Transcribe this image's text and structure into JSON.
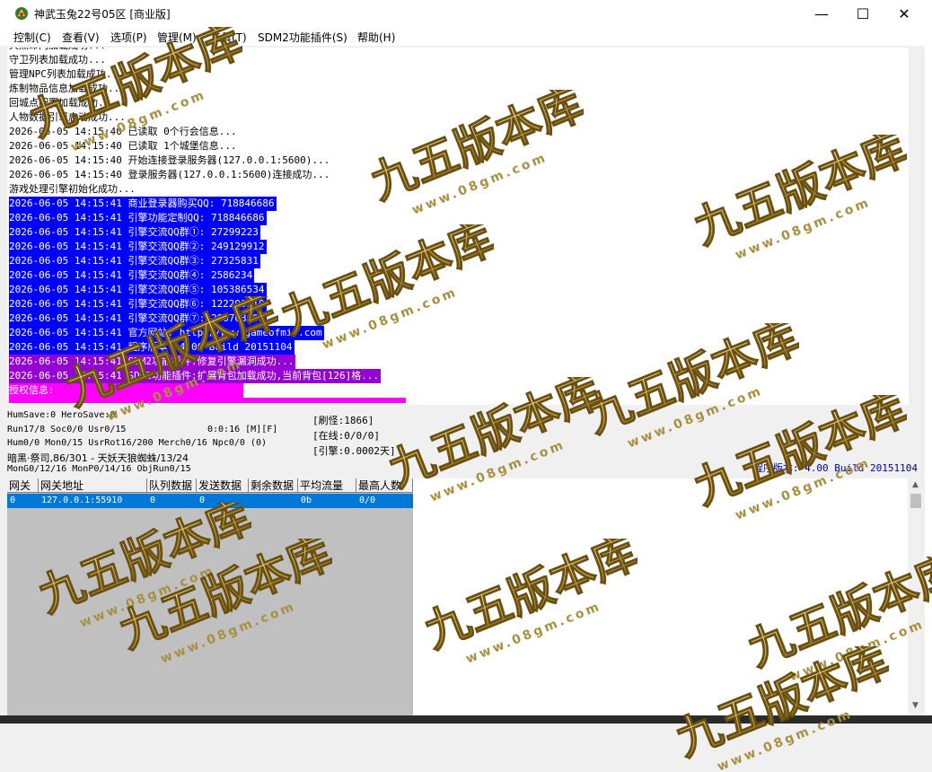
{
  "window": {
    "title": "神武玉兔22号05区 [商业版]",
    "controls": {
      "minimize": "—",
      "maximize": "☐",
      "close": "✕"
    }
  },
  "menu": [
    "控制(C)",
    "查看(V)",
    "选项(P)",
    "管理(M)",
    "工具(T)",
    "SDM2功能插件(S)",
    "帮助(H)"
  ],
  "log": {
    "lines": [
      {
        "text": "天然命内加载成功...",
        "style": "plain"
      },
      {
        "text": "守卫列表加载成功...",
        "style": "plain"
      },
      {
        "text": "管理NPC列表加载成功...",
        "style": "plain"
      },
      {
        "text": "炼制物品信息加载成功...",
        "style": "plain"
      },
      {
        "text": "回城点配置加载成功...",
        "style": "plain"
      },
      {
        "text": "人物数据引擎启动成功...",
        "style": "plain"
      },
      {
        "text": "2026-06-05 14:15:40 已读取 0个行会信息...",
        "style": "plain"
      },
      {
        "text": "2026-06-05 14:15:40 已读取 1个城堡信息...",
        "style": "plain"
      },
      {
        "text": "2026-06-05 14:15:40 开始连接登录服务器(127.0.0.1:5600)...",
        "style": "plain"
      },
      {
        "text": "2026-06-05 14:15:40 登录服务器(127.0.0.1:5600)连接成功...",
        "style": "plain"
      },
      {
        "text": "游戏处理引擎初始化成功...",
        "style": "plain"
      },
      {
        "text": "2026-06-05 14:15:41 商业登录器购买QQ: 718846686",
        "style": "blue"
      },
      {
        "text": "2026-06-05 14:15:41 引擎功能定制QQ: 718846686",
        "style": "blue"
      },
      {
        "text": "2026-06-05 14:15:41 引擎交流QQ群①: 27299223",
        "style": "blue"
      },
      {
        "text": "2026-06-05 14:15:41 引擎交流QQ群②: 249129912",
        "style": "blue"
      },
      {
        "text": "2026-06-05 14:15:41 引擎交流QQ群③: 27325831",
        "style": "blue"
      },
      {
        "text": "2026-06-05 14:15:41 引擎交流QQ群④: 2586234",
        "style": "blue"
      },
      {
        "text": "2026-06-05 14:15:41 引擎交流QQ群⑤: 105386534",
        "style": "blue"
      },
      {
        "text": "2026-06-05 14:15:41 引擎交流QQ群⑥: 122299510",
        "style": "blue"
      },
      {
        "text": "2026-06-05 14:15:41 引擎交流QQ群⑦: 286703001",
        "style": "blue"
      },
      {
        "text": "2026-06-05 14:15:41 官方网站: http://www.gameofmir.com",
        "style": "blue"
      },
      {
        "text": "2026-06-05 14:15:41 程序版本: 4.00 Build 20151104",
        "style": "blue"
      },
      {
        "text": "2026-06-05 14:15:41 SDM2功能插件:修复引擎漏洞成功...",
        "style": "purple"
      },
      {
        "text": "2026-06-05 14:15:41 SDM2功能插件:扩展背包加载成功,当前背包[126]格...",
        "style": "purple"
      },
      {
        "text": "授权信息:",
        "style": "magenta"
      },
      {
        "text": "",
        "style": "magenta-partial"
      }
    ]
  },
  "status": {
    "line1": "HumSave:0 HeroSave:0",
    "line2": "Run17/8 Soc0/0 Usr0/15",
    "timer": "0:0:16 [M][F]",
    "line3": "Hum0/0 Mon0/15 UsrRot16/200 Merch0/16 Npc0/0 (0)",
    "line4": "暗黑·祭司,86/301 - 天妖天狼蜘蛛/13/24",
    "line5": "MonG0/12/16 MonP0/14/16 ObjRun0/15",
    "refresh": "[刷怪:1866]",
    "online": "[在线:0/0/0]",
    "engine": "[引擎:0.0002天]",
    "version": "程序版本: 4.00 Build 20151104"
  },
  "gate_table": {
    "headers": [
      "网关",
      "网关地址",
      "队列数据",
      "发送数据",
      "剩余数据",
      "平均流量",
      "最高人数"
    ],
    "rows": [
      [
        "0",
        "127.0.0.1:55910",
        "0",
        "0",
        "",
        "0b",
        "0/0"
      ]
    ]
  },
  "watermark": {
    "text": "九五版本库",
    "url": "www.08gm.com"
  },
  "colors": {
    "selection_blue": "#0000ff",
    "purple": "#9400d3",
    "magenta": "#ff00ff",
    "table_bg": "#eaffea",
    "row_highlight": "#0078d7",
    "version_text": "#0000a0"
  }
}
